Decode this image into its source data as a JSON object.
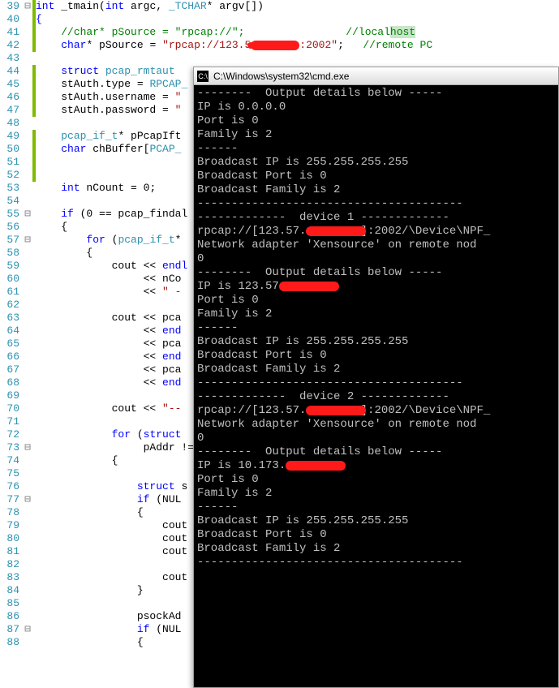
{
  "code": {
    "lines": [
      {
        "n": 39,
        "fold": "⊟",
        "ch": true,
        "html": "<span class='kw'>int</span> _tmain(<span class='kw'>int</span> argc, <span class='typ'>_TCHAR</span>* argv[])"
      },
      {
        "n": 40,
        "fold": "",
        "ch": true,
        "html": "<span class='kw'>{</span>"
      },
      {
        "n": 41,
        "fold": "",
        "ch": true,
        "html": "    <span class='cmt'>//char* pSource = \"rpcap://\";</span>                <span class='cmt'>//local<span class='hl'>host</span></span>"
      },
      {
        "n": 42,
        "fold": "",
        "ch": true,
        "html": "    <span class='kw'>char</span>* pSource = <span class='str'>\"rpcap://123.5</span><span class='red-scribble'></span><span class='str'>:2002\"</span>;   <span class='cmt'>//remote PC</span>"
      },
      {
        "n": 43,
        "fold": "",
        "ch": false,
        "html": ""
      },
      {
        "n": 44,
        "fold": "",
        "ch": true,
        "html": "    <span class='kw'>struct</span> <span class='typ'>pcap_rmtaut</span>"
      },
      {
        "n": 45,
        "fold": "",
        "ch": true,
        "html": "    stAuth.type = <span class='typ'>RPCAP_</span>"
      },
      {
        "n": 46,
        "fold": "",
        "ch": true,
        "html": "    stAuth.username = <span class='str'>\"</span>"
      },
      {
        "n": 47,
        "fold": "",
        "ch": true,
        "html": "    stAuth.password = <span class='str'>\"</span>"
      },
      {
        "n": 48,
        "fold": "",
        "ch": false,
        "html": ""
      },
      {
        "n": 49,
        "fold": "",
        "ch": true,
        "html": "    <span class='typ'>pcap_if_t</span>* pPcapIft"
      },
      {
        "n": 50,
        "fold": "",
        "ch": true,
        "html": "    <span class='kw'>char</span> chBuffer[<span class='typ'>PCAP_</span>"
      },
      {
        "n": 51,
        "fold": "",
        "ch": true,
        "html": ""
      },
      {
        "n": 52,
        "fold": "",
        "ch": true,
        "html": ""
      },
      {
        "n": 53,
        "fold": "",
        "ch": false,
        "html": "    <span class='kw'>int</span> nCount = 0;"
      },
      {
        "n": 54,
        "fold": "",
        "ch": false,
        "html": ""
      },
      {
        "n": 55,
        "fold": "⊟",
        "ch": false,
        "html": "    <span class='kw'>if</span> (0 == pcap_findal"
      },
      {
        "n": 56,
        "fold": "",
        "ch": false,
        "html": "    {"
      },
      {
        "n": 57,
        "fold": "⊟",
        "ch": false,
        "html": "        <span class='kw'>for</span> (<span class='typ'>pcap_if_t</span>*"
      },
      {
        "n": 58,
        "fold": "",
        "ch": false,
        "html": "        {"
      },
      {
        "n": 59,
        "fold": "",
        "ch": false,
        "html": "            cout &lt;&lt; <span class='kw'>endl</span>"
      },
      {
        "n": 60,
        "fold": "",
        "ch": false,
        "html": "                 &lt;&lt; nCo"
      },
      {
        "n": 61,
        "fold": "",
        "ch": false,
        "html": "                 &lt;&lt; <span class='str'>\" -</span>"
      },
      {
        "n": 62,
        "fold": "",
        "ch": false,
        "html": ""
      },
      {
        "n": 63,
        "fold": "",
        "ch": false,
        "html": "            cout &lt;&lt; pca"
      },
      {
        "n": 64,
        "fold": "",
        "ch": false,
        "html": "                 &lt;&lt; <span class='kw'>end</span>"
      },
      {
        "n": 65,
        "fold": "",
        "ch": false,
        "html": "                 &lt;&lt; pca"
      },
      {
        "n": 66,
        "fold": "",
        "ch": false,
        "html": "                 &lt;&lt; <span class='kw'>end</span>"
      },
      {
        "n": 67,
        "fold": "",
        "ch": false,
        "html": "                 &lt;&lt; pca"
      },
      {
        "n": 68,
        "fold": "",
        "ch": false,
        "html": "                 &lt;&lt; <span class='kw'>end</span>"
      },
      {
        "n": 69,
        "fold": "",
        "ch": false,
        "html": ""
      },
      {
        "n": 70,
        "fold": "",
        "ch": false,
        "html": "            cout &lt;&lt; <span class='str'>\"--</span>"
      },
      {
        "n": 71,
        "fold": "",
        "ch": false,
        "html": ""
      },
      {
        "n": 72,
        "fold": "",
        "ch": false,
        "html": "            <span class='kw'>for</span> (<span class='kw'>struct</span>"
      },
      {
        "n": 73,
        "fold": "⊟",
        "ch": false,
        "html": "                 pAddr !="
      },
      {
        "n": 74,
        "fold": "",
        "ch": false,
        "html": "            {"
      },
      {
        "n": 75,
        "fold": "",
        "ch": false,
        "html": ""
      },
      {
        "n": 76,
        "fold": "",
        "ch": false,
        "html": "                <span class='kw'>struct</span> s"
      },
      {
        "n": 77,
        "fold": "⊟",
        "ch": false,
        "html": "                <span class='kw'>if</span> (NUL"
      },
      {
        "n": 78,
        "fold": "",
        "ch": false,
        "html": "                {"
      },
      {
        "n": 79,
        "fold": "",
        "ch": false,
        "html": "                    cout"
      },
      {
        "n": 80,
        "fold": "",
        "ch": false,
        "html": "                    cout"
      },
      {
        "n": 81,
        "fold": "",
        "ch": false,
        "html": "                    cout"
      },
      {
        "n": 82,
        "fold": "",
        "ch": false,
        "html": ""
      },
      {
        "n": 83,
        "fold": "",
        "ch": false,
        "html": "                    cout"
      },
      {
        "n": 84,
        "fold": "",
        "ch": false,
        "html": "                }"
      },
      {
        "n": 85,
        "fold": "",
        "ch": false,
        "html": ""
      },
      {
        "n": 86,
        "fold": "",
        "ch": false,
        "html": "                psockAd"
      },
      {
        "n": 87,
        "fold": "⊟",
        "ch": false,
        "html": "                <span class='kw'>if</span> (NUL"
      },
      {
        "n": 88,
        "fold": "",
        "ch": false,
        "html": "                {"
      }
    ]
  },
  "console": {
    "title": "C:\\Windows\\system32\\cmd.exe",
    "icon_label": "C:\\",
    "lines": [
      "--------  Output details below -----",
      "IP is 0.0.0.0",
      "Port is 0",
      "Family is 2",
      "------",
      "Broadcast IP is 255.255.255.255",
      "Broadcast Port is 0",
      "Broadcast Family is 2",
      "---------------------------------------",
      "",
      "",
      "-------------  device 1 -------------",
      {
        "pre": "rpcap://[123.57.",
        "redact": true,
        "post": "]:2002/\\Device\\NPF_"
      },
      "Network adapter 'Xensource' on remote nod",
      "0",
      "--------  Output details below -----",
      {
        "pre": "IP is 123.57",
        "redact": true,
        "post": ""
      },
      "Port is 0",
      "Family is 2",
      "------",
      "Broadcast IP is 255.255.255.255",
      "Broadcast Port is 0",
      "Broadcast Family is 2",
      "---------------------------------------",
      "",
      "",
      "-------------  device 2 -------------",
      {
        "pre": "rpcap://[123.57.",
        "redact": true,
        "post": "]:2002/\\Device\\NPF_"
      },
      "Network adapter 'Xensource' on remote nod",
      "0",
      "--------  Output details below -----",
      {
        "pre": "IP is 10.173.",
        "redact": true,
        "post": ""
      },
      "Port is 0",
      "Family is 2",
      "------",
      "Broadcast IP is 255.255.255.255",
      "Broadcast Port is 0",
      "Broadcast Family is 2",
      "---------------------------------------"
    ]
  }
}
